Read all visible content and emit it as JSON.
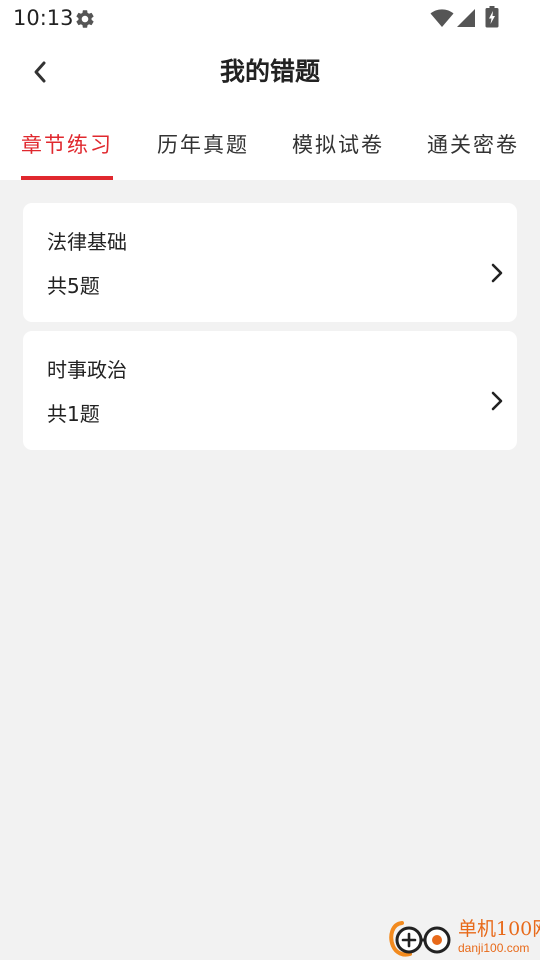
{
  "status_bar": {
    "time": "10:13",
    "icons": [
      "gear-icon",
      "wifi-icon",
      "signal-icon",
      "battery-icon"
    ]
  },
  "header": {
    "title": "我的错题",
    "back_icon": "chevron-left-icon"
  },
  "tabs": [
    {
      "label": "章节练习",
      "active": true
    },
    {
      "label": "历年真题",
      "active": false
    },
    {
      "label": "模拟试卷",
      "active": false
    },
    {
      "label": "通关密卷",
      "active": false
    }
  ],
  "items": [
    {
      "title": "法律基础",
      "count": "共5题"
    },
    {
      "title": "时事政治",
      "count": "共1题"
    }
  ],
  "watermark": {
    "name": "单机100网",
    "url": "danji100.com"
  },
  "colors": {
    "accent": "#e0282e",
    "background": "#f2f2f2",
    "card": "#ffffff",
    "watermark": "#e86a1a"
  }
}
